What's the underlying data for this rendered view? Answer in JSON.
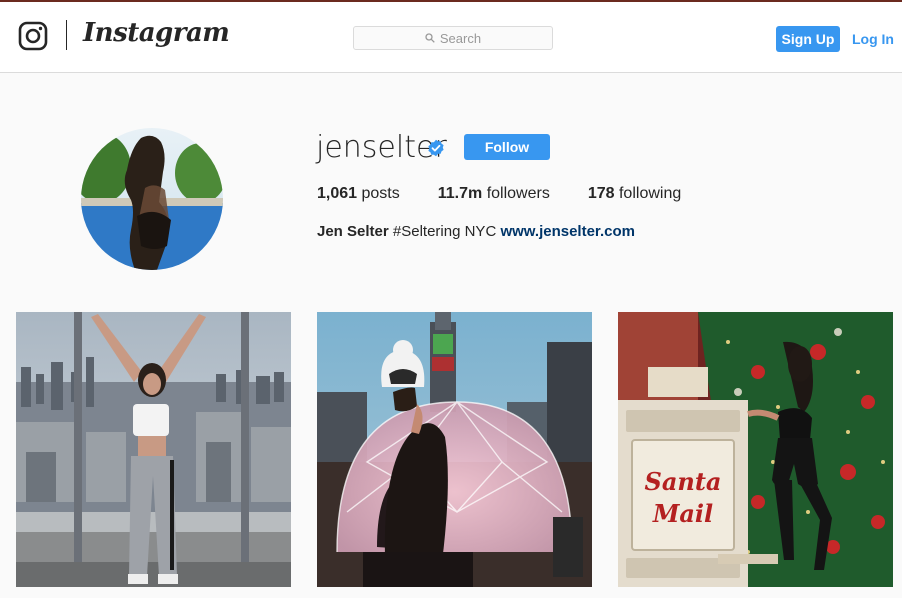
{
  "header": {
    "wordmark": "Instagram",
    "search_placeholder": "Search",
    "signup_label": "Sign Up",
    "login_label": "Log In"
  },
  "profile": {
    "username": "jenselter",
    "verified": true,
    "follow_label": "Follow",
    "stats": {
      "posts_count": "1,061",
      "posts_label": "posts",
      "followers_count": "11.7m",
      "followers_label": "followers",
      "following_count": "178",
      "following_label": "following"
    },
    "bio": {
      "name": "Jen Selter",
      "text": "#Seltering NYC",
      "link": "www.jenselter.com"
    }
  },
  "posts": [
    {
      "alt": "post-1"
    },
    {
      "alt": "post-2"
    },
    {
      "alt": "post-3",
      "sign_text": "Santa Mail"
    }
  ],
  "colors": {
    "accent": "#3897f0",
    "link": "#003569",
    "border": "#dbdbdb",
    "background": "#fafafa"
  }
}
